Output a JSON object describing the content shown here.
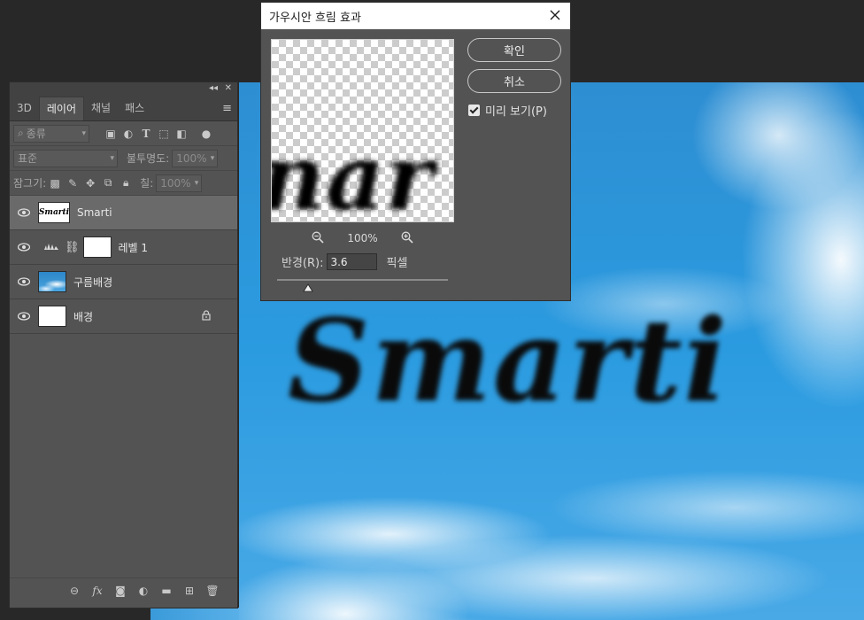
{
  "dialog": {
    "title": "가우시안 흐림 효과",
    "ok_label": "확인",
    "cancel_label": "취소",
    "preview_label": "미리 보기(P)",
    "preview_checked": true,
    "zoom_level": "100%",
    "radius_label": "반경(R):",
    "radius_value": "3.6",
    "radius_unit": "픽셀",
    "radius_slider_fraction": 0.18,
    "preview_text": "nar"
  },
  "layers_panel": {
    "tabs": [
      {
        "label": "3D"
      },
      {
        "label": "레이어"
      },
      {
        "label": "채널"
      },
      {
        "label": "패스"
      }
    ],
    "active_tab": "레이어",
    "filter_kind": "종류",
    "blend_mode": "표준",
    "opacity_label": "불투명도:",
    "opacity_value": "100%",
    "lock_label": "잠그기:",
    "fill_label": "칠:",
    "fill_value": "100%",
    "layers": [
      {
        "name": "Smarti",
        "thumb_text": "Smarti",
        "selected": true
      },
      {
        "name": "레벨 1",
        "type": "adjustment"
      },
      {
        "name": "구름배경",
        "type": "image"
      },
      {
        "name": "배경",
        "locked": true
      }
    ]
  },
  "canvas": {
    "text": "Smarti"
  },
  "colors": {
    "panel_bg": "#535353",
    "app_bg": "#282828",
    "sky_blue": "#2b9be0"
  }
}
